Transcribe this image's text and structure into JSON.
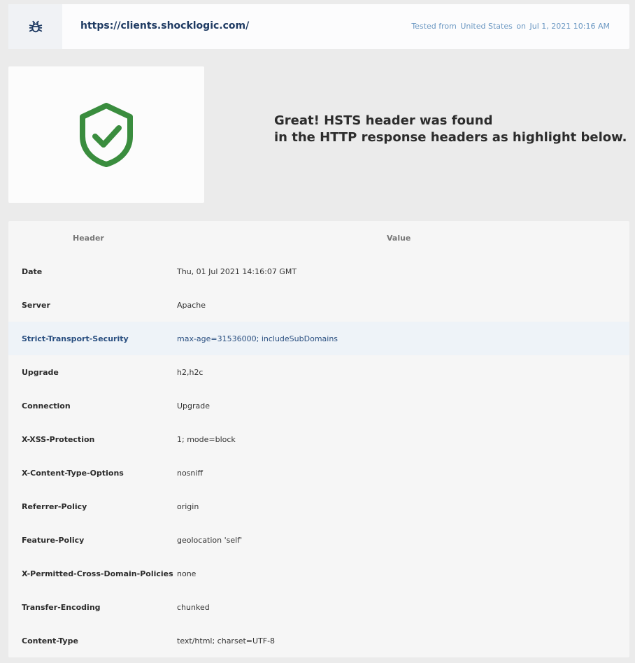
{
  "top_bar": {
    "icon": "bug-icon",
    "url": "https://clients.shocklogic.com/",
    "tested_from_label": "Tested from",
    "country": "United States",
    "on_label": "on",
    "date": "Jul 1, 2021 10:16 AM"
  },
  "result": {
    "icon": "shield-check-icon",
    "icon_color": "#3a8d3e",
    "line1": "Great! HSTS header was found",
    "line2": "in the HTTP response headers as highlight below."
  },
  "table": {
    "header_col": "Header",
    "value_col": "Value",
    "rows": [
      {
        "k": "Date",
        "v": "Thu, 01 Jul 2021 14:16:07 GMT"
      },
      {
        "k": "Server",
        "v": "Apache"
      },
      {
        "k": "Strict-Transport-Security",
        "v": "max-age=31536000; includeSubDomains"
      },
      {
        "k": "Upgrade",
        "v": "h2,h2c"
      },
      {
        "k": "Connection",
        "v": "Upgrade"
      },
      {
        "k": "X-XSS-Protection",
        "v": "1; mode=block"
      },
      {
        "k": "X-Content-Type-Options",
        "v": "nosniff"
      },
      {
        "k": "Referrer-Policy",
        "v": "origin"
      },
      {
        "k": "Feature-Policy",
        "v": "geolocation 'self'"
      },
      {
        "k": "X-Permitted-Cross-Domain-Policies",
        "v": "none"
      },
      {
        "k": "Transfer-Encoding",
        "v": "chunked"
      },
      {
        "k": "Content-Type",
        "v": "text/html; charset=UTF-8"
      }
    ],
    "highlight_color": "#eef3f8"
  }
}
